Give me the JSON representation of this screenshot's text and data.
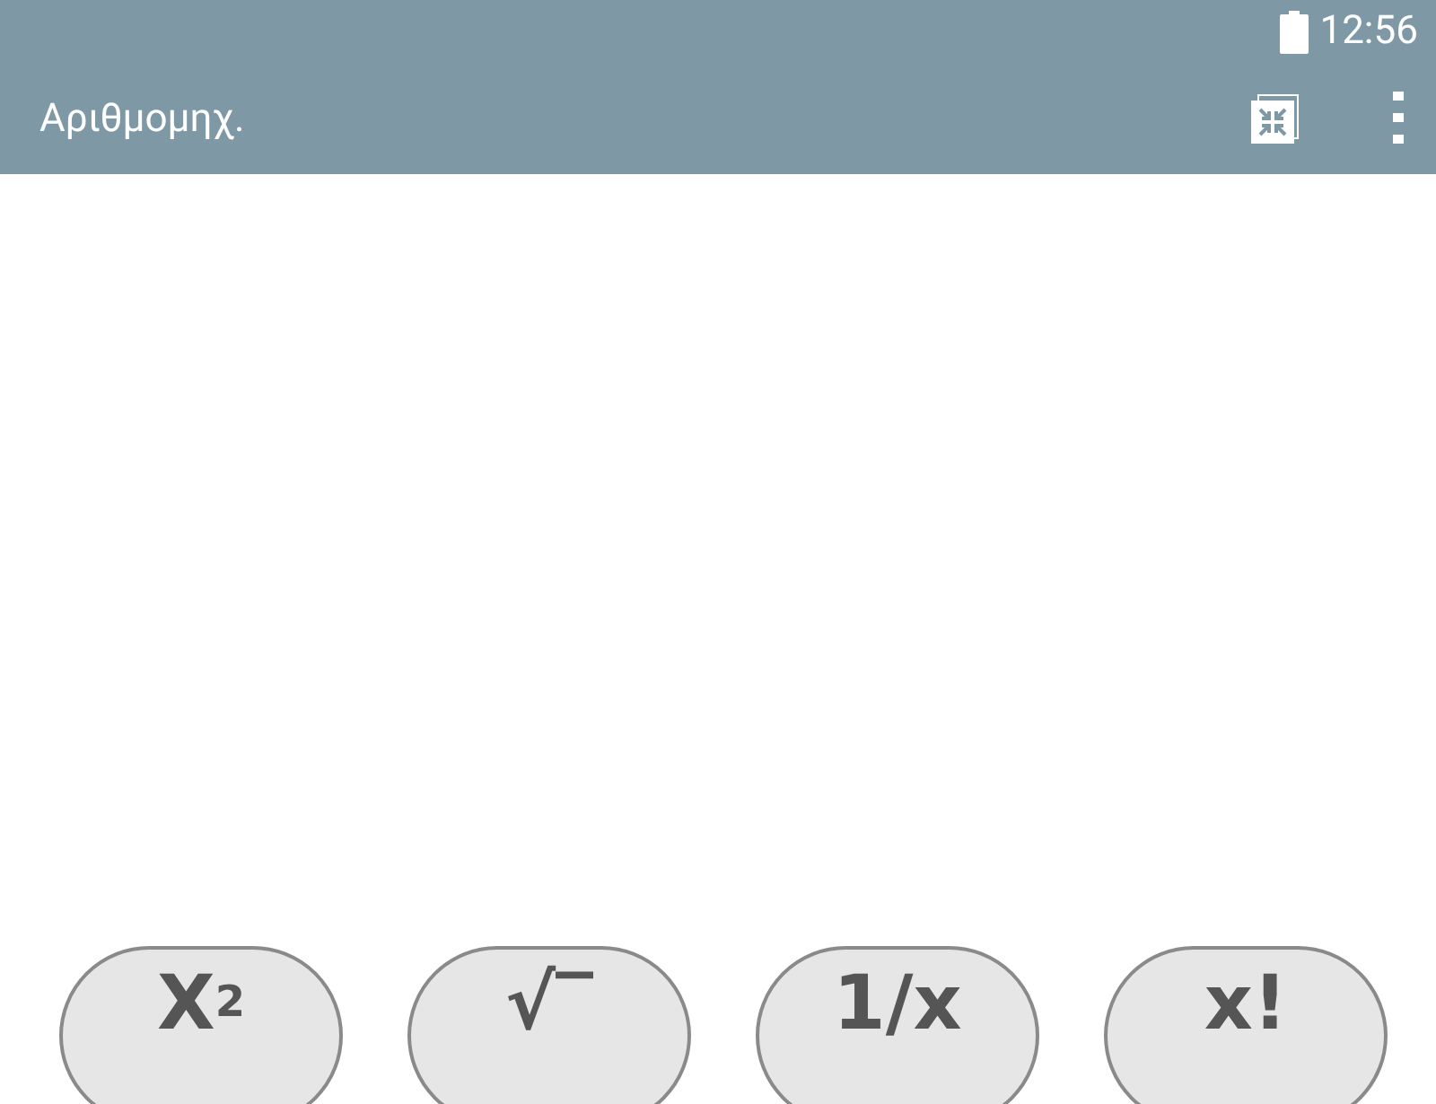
{
  "status_bar": {
    "time": "12:56"
  },
  "app_bar": {
    "title": "Αριθμομηχ."
  },
  "keys": [
    {
      "label": "X$^{2}$"
    },
    {
      "label": "√‾"
    },
    {
      "label": "1/x"
    },
    {
      "label": "x!"
    }
  ]
}
